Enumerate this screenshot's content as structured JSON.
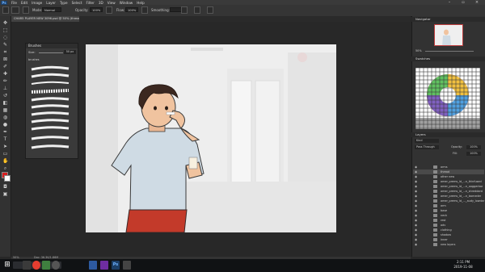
{
  "menu": {
    "logo": "Ps",
    "items": [
      "File",
      "Edit",
      "Image",
      "Layer",
      "Type",
      "Select",
      "Filter",
      "3D",
      "View",
      "Window",
      "Help"
    ]
  },
  "options": {
    "mode_label": "Mode:",
    "mode_value": "Normal",
    "opacity_label": "Opacity:",
    "opacity_value": "100%",
    "flow_label": "Flow:",
    "flow_value": "100%",
    "smoothing_label": "Smoothing:"
  },
  "document": {
    "tab_title": "CHAR5 PLAYER NEW 3096.psd @ 50% (thread, RGB/8)"
  },
  "brushes_panel": {
    "title": "Brushes",
    "size_label": "Size:",
    "size_value": "50 px",
    "folder_label": "brushes"
  },
  "navigator": {
    "title": "Navigator",
    "zoom_value": "50%"
  },
  "swatches": {
    "title": "Swatches"
  },
  "layers": {
    "title": "Layers",
    "kind_label": "Kind",
    "blend_value": "Pass Through",
    "opacity_label": "Opacity:",
    "opacity_value": "100%",
    "fill_label": "Fill:",
    "fill_value": "100%",
    "items": [
      "arms",
      "thread",
      "other new",
      "amer_prems_ld_...n_thinfused",
      "amer_prems_ld_...n_ooggerbar",
      "amer_prems_ld_...n_shreddard",
      "amer_prems_ld_...n_barneder",
      "amer_prems_ld_..._audy_lowdar",
      "arm",
      "base",
      "neck",
      "rest",
      "adv",
      "clothing",
      "shadow",
      "inner",
      "new layers"
    ]
  },
  "status": {
    "zoom": "50%",
    "doc": "Doc: 36.3K/1.86M"
  },
  "taskbar": {
    "time": "2:11 PM",
    "date": "2019-11-08"
  },
  "colors": {
    "foreground": "#d62020",
    "background": "#ffffff",
    "accent": "#1c3f67"
  }
}
